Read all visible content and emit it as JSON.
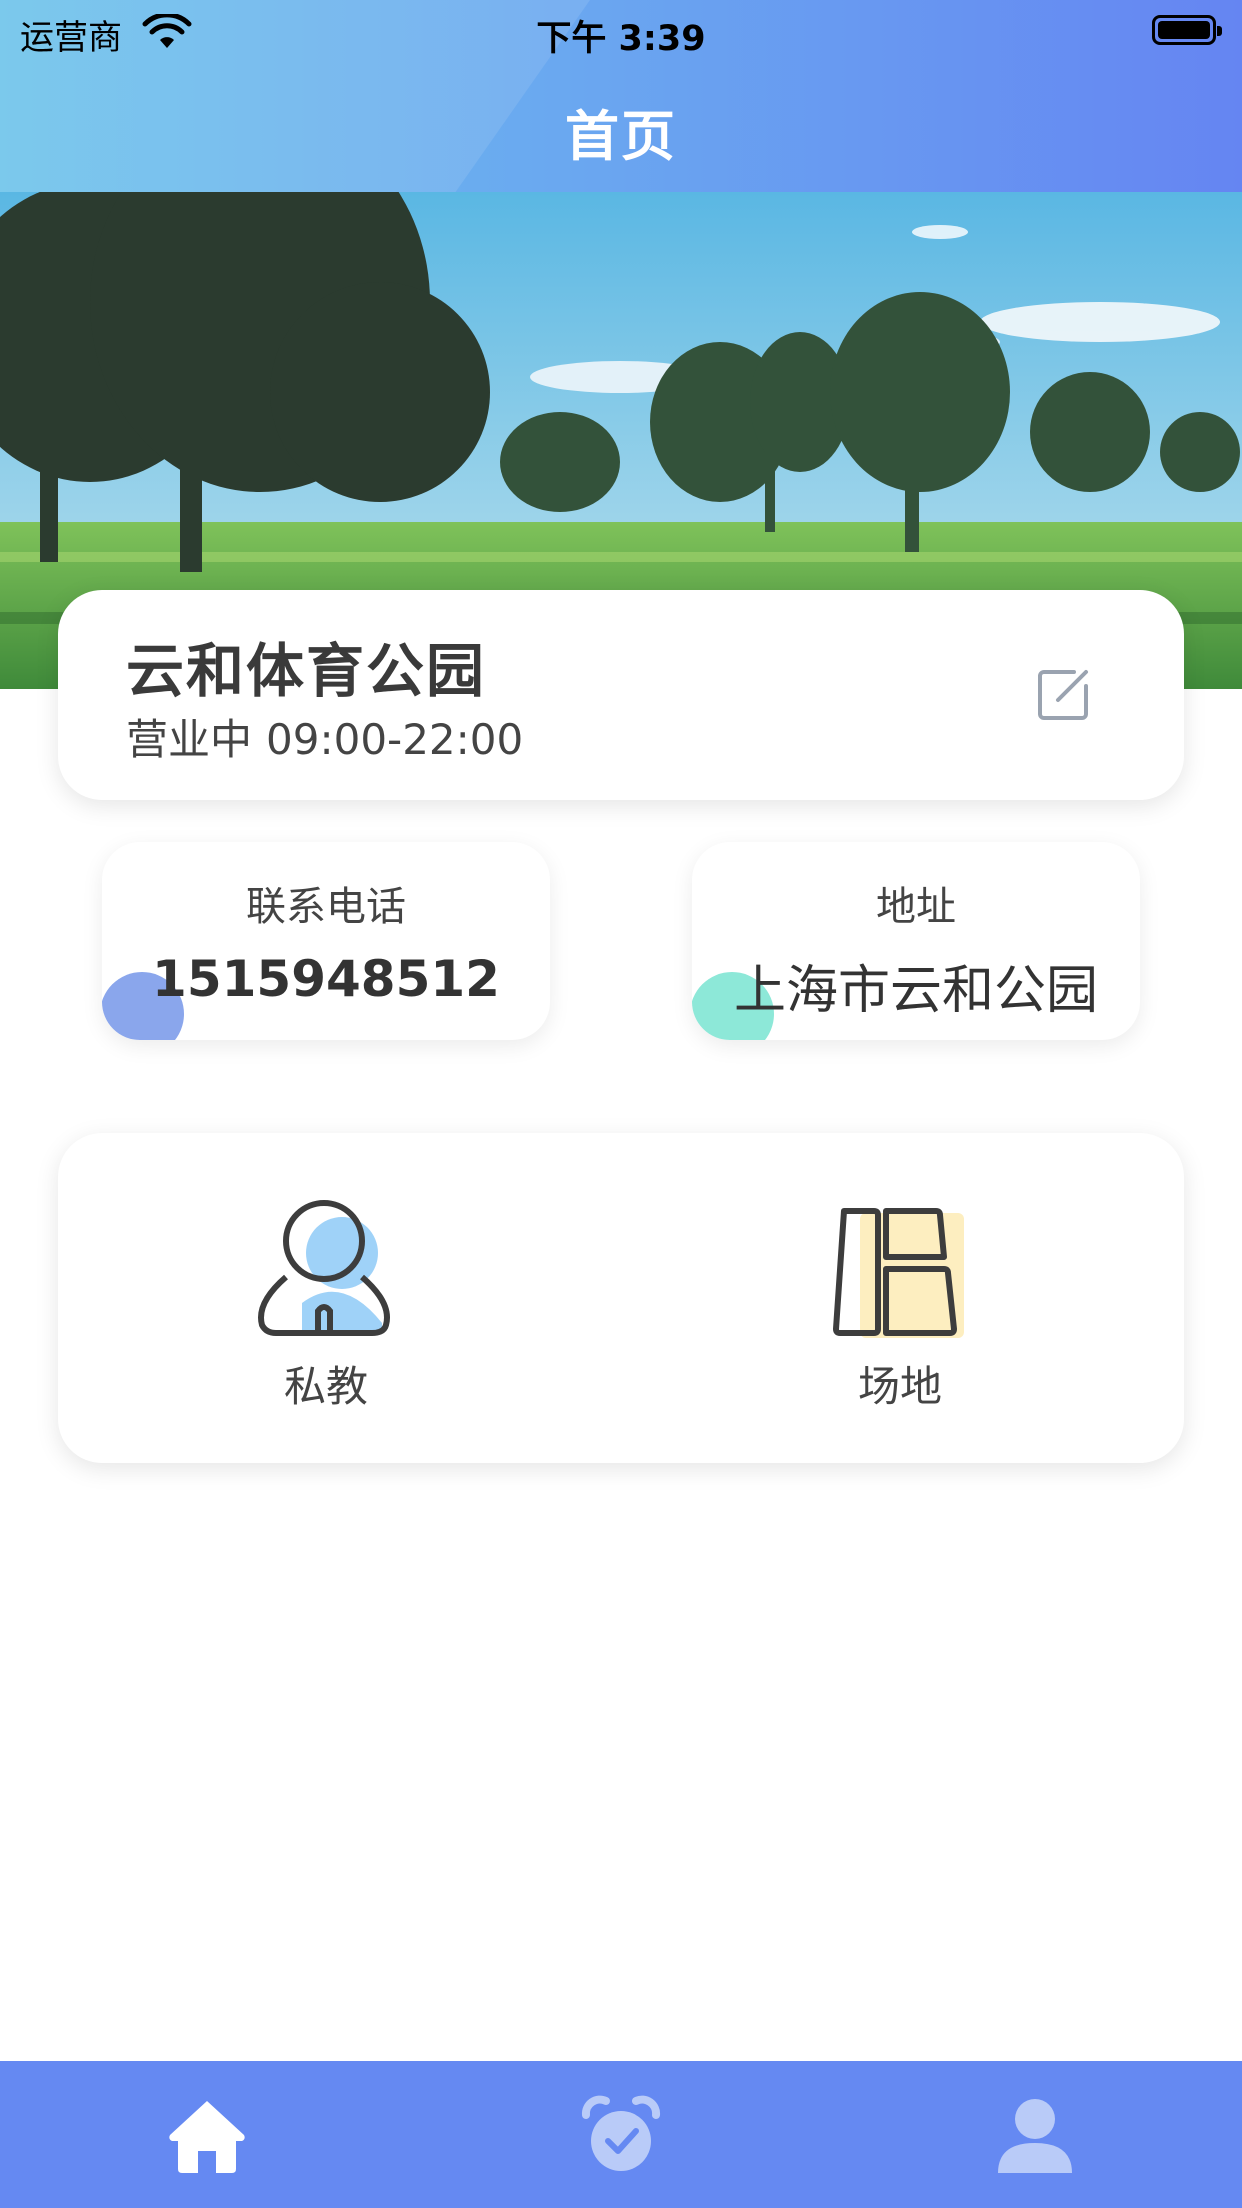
{
  "status_bar": {
    "carrier": "运营商",
    "time": "下午 3:39"
  },
  "header": {
    "title": "首页"
  },
  "venue": {
    "name": "云和体育公园",
    "status": "营业中",
    "hours": "09:00-22:00"
  },
  "contact": {
    "phone_label": "联系电话",
    "phone_value": "1515948512",
    "address_label": "地址",
    "address_value": "上海市云和公园"
  },
  "menu": {
    "coach_label": "私教",
    "venue_label": "场地"
  },
  "tabbar": {
    "items": [
      "home-icon",
      "alarm-clock-icon",
      "profile-icon"
    ],
    "active": "home-icon"
  },
  "colors": {
    "header_gradient_start": "#6cc3ea",
    "header_gradient_end": "#6585f2",
    "tabbar": "#6589f2",
    "phone_accent": "#8aa6ec",
    "address_accent": "#8de8d8",
    "coach_icon_accent": "#9fd2f8",
    "venue_icon_accent": "#fdeec0"
  }
}
